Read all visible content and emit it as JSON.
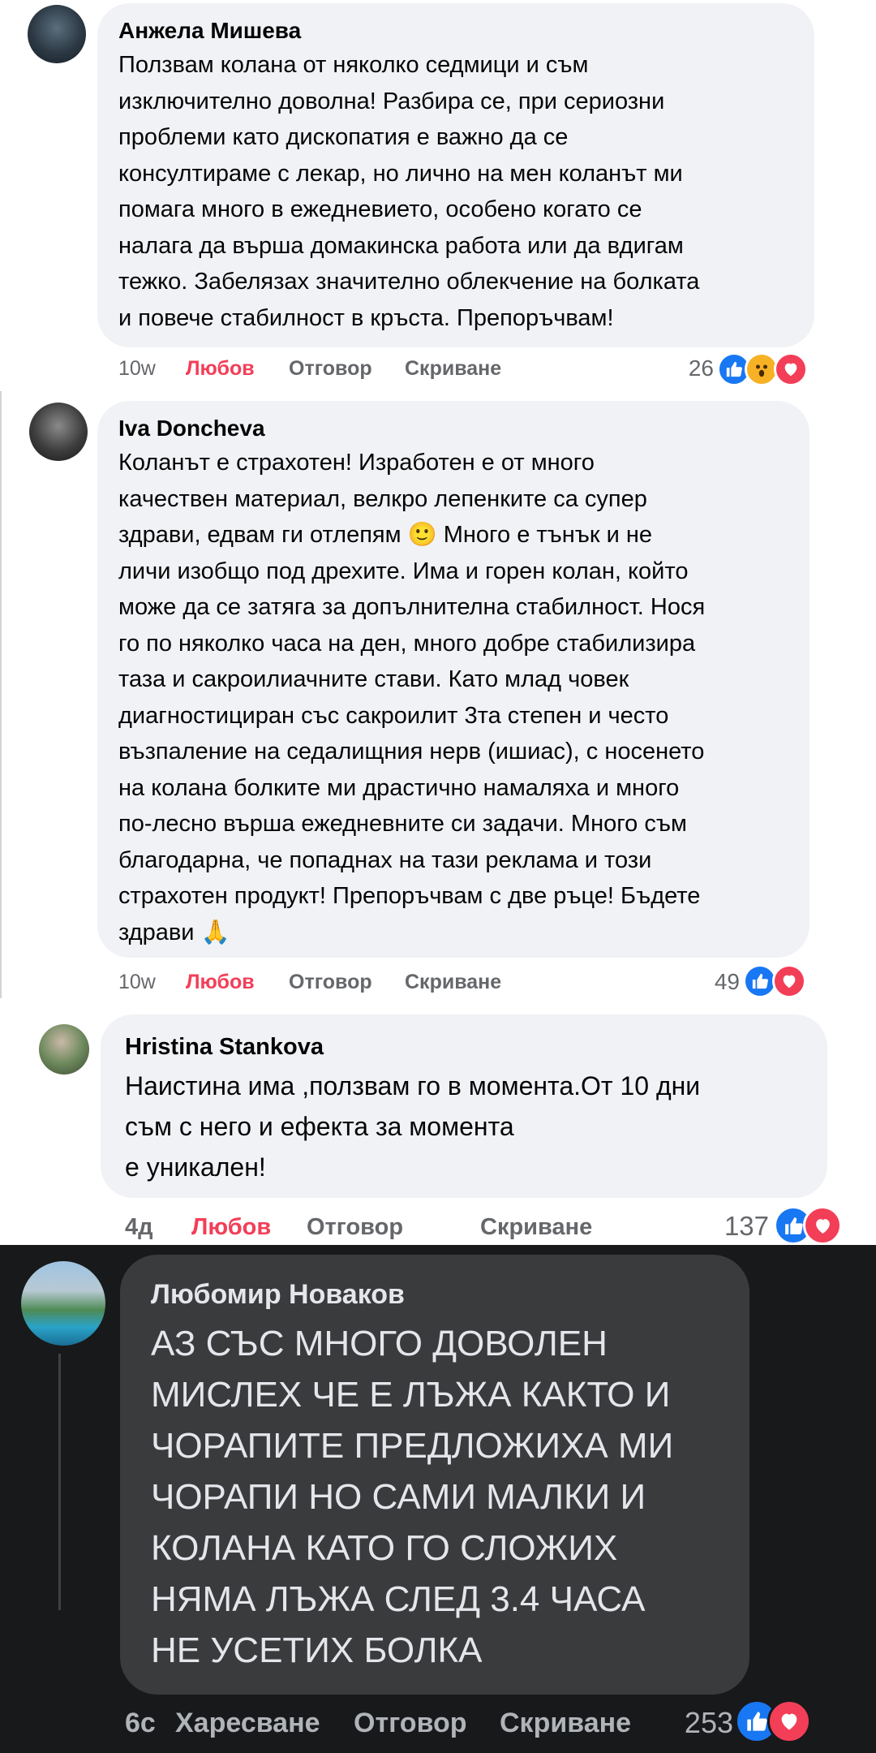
{
  "colors": {
    "like": "#1877f2",
    "love": "#f33e58",
    "wow": "#f7b125",
    "bubble": "#f0f2f5",
    "dark_bg": "#18191a",
    "dark_bubble": "#3a3b3c"
  },
  "comments": [
    {
      "author": "Анжела Мишева",
      "lines": [
        "Ползвам колана от няколко седмици и съм",
        "изключително доволна! Разбира се, при сериозни",
        "проблеми като дископатия е важно да се",
        "консултираме с лекар, но лично на мен коланът ми",
        "помага много в ежедневието, особено когато се",
        "налага да върша домакинска работа или да вдигам",
        "тежко. Забелязах значително облекчение на болката",
        "и повече стабилност в кръста. Препоръчвам!"
      ],
      "time": "10w",
      "love": "Любов",
      "reply": "Отговор",
      "hide": "Скриване",
      "count": "26",
      "reactions": [
        "like-icon",
        "wow-icon",
        "heart-icon"
      ]
    },
    {
      "author": "Iva Doncheva",
      "lines": [
        "Коланът е страхотен! Изработен е от много",
        "качествен материал, велкро лепенките са супер",
        "здрави, едвам ги отлепям 🙂 Много е тънък и не",
        "личи изобщо под дрехите. Има и горен колан, който",
        "може да се затяга за допълнителна стабилност. Нося",
        "го по няколко часа на ден, много добре стабилизира",
        "таза и сакроилиачните стави. Като млад човек",
        "диагностициран със сакроилит 3та степен и често",
        "възпаление на седалищния нерв (ишиас), с носенето",
        "на колана болките ми драстично намаляха и много",
        "по-лесно върша ежедневните си задачи. Много съм",
        "благодарна, че попаднах на тази реклама и този",
        "страхотен продукт! Препоръчвам с две ръце! Бъдете",
        "здрави 🙏"
      ],
      "time": "10w",
      "love": "Любов",
      "reply": "Отговор",
      "hide": "Скриване",
      "count": "49",
      "reactions": [
        "like-icon",
        "heart-icon"
      ]
    },
    {
      "author": "Hristina Stankova",
      "lines": [
        "Наистина има ,ползвам го в момента.От 10 дни",
        "съм с него и ефекта за момента",
        "е уникален!"
      ],
      "time": "4д",
      "love": "Любов",
      "reply": "Отговор",
      "hide": "Скриване",
      "count": "137",
      "reactions": [
        "like-icon",
        "heart-icon"
      ]
    },
    {
      "author": "Любомир Новаков",
      "lines": [
        "АЗ СЪС МНОГО ДОВОЛЕН",
        "МИСЛЕХ ЧЕ Е ЛЪЖА КАКТО И",
        "ЧОРАПИТЕ ПРЕДЛОЖИХА МИ",
        "ЧОРАПИ НО САМИ МАЛКИ И",
        "КОЛАНА КАТО ГО СЛОЖИХ",
        "НЯМА ЛЪЖА СЛЕД 3.4 ЧАСА",
        "НЕ УСЕТИХ БОЛКА"
      ],
      "time": "6с",
      "like": "Харесване",
      "reply": "Отговор",
      "hide": "Скриване",
      "count": "253",
      "reactions": [
        "like-icon",
        "heart-icon"
      ]
    }
  ]
}
